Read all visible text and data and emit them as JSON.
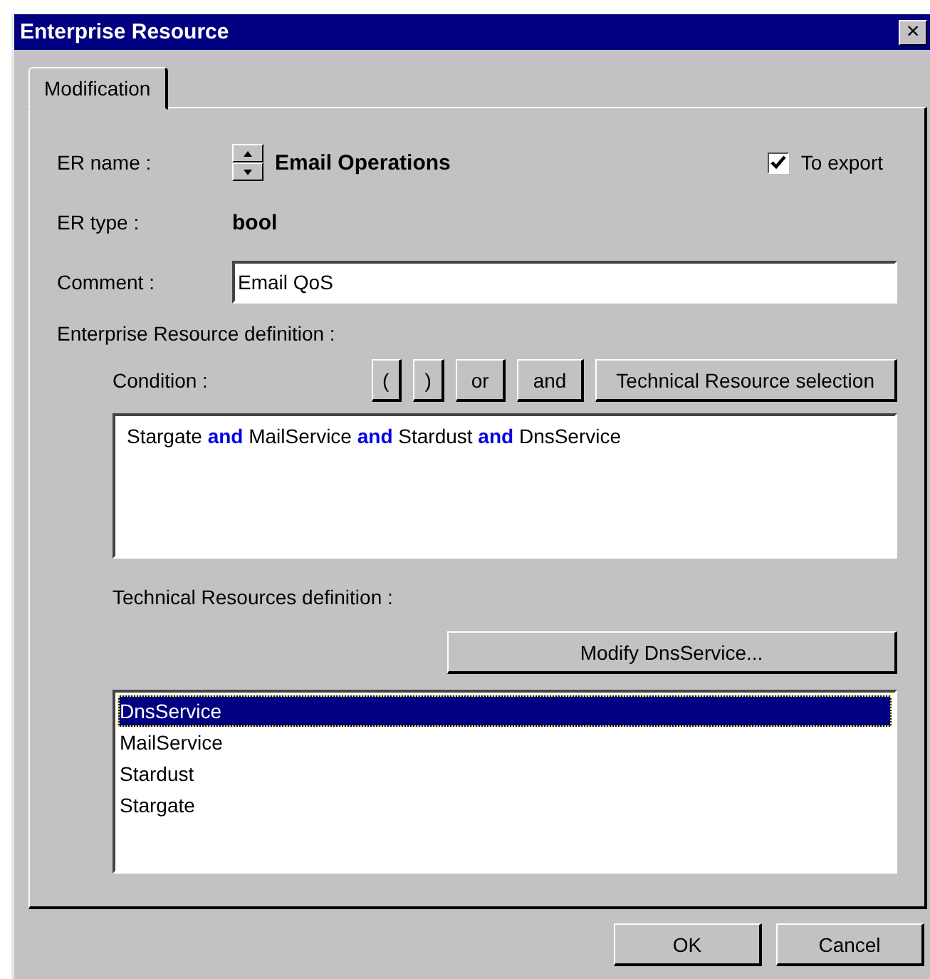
{
  "window": {
    "title": "Enterprise Resource",
    "close": "×"
  },
  "tabs": [
    {
      "label": "Modification",
      "selected": true
    }
  ],
  "er_name": {
    "label": "ER name :",
    "value": "Email Operations"
  },
  "to_export": {
    "label": "To export",
    "checked": true
  },
  "er_type": {
    "label": "ER type :",
    "value": "bool"
  },
  "comment": {
    "label": "Comment :",
    "value": "Email QoS"
  },
  "definition_label": "Enterprise Resource definition :",
  "condition": {
    "label": "Condition :",
    "buttons": [
      "(",
      ")",
      "or",
      "and",
      "Technical Resource selection"
    ],
    "expression": "Stargate **and** MailService **and** Stardust **and** DnsService"
  },
  "technical_label": "Technical Resources definition :",
  "modify_button": "Modify DnsService...",
  "resources": [
    {
      "label": "DnsService",
      "selected": true
    },
    {
      "label": "MailService",
      "selected": false
    },
    {
      "label": "Stardust",
      "selected": false
    },
    {
      "label": "Stargate",
      "selected": false
    }
  ],
  "buttons": [
    "OK",
    "Cancel"
  ]
}
